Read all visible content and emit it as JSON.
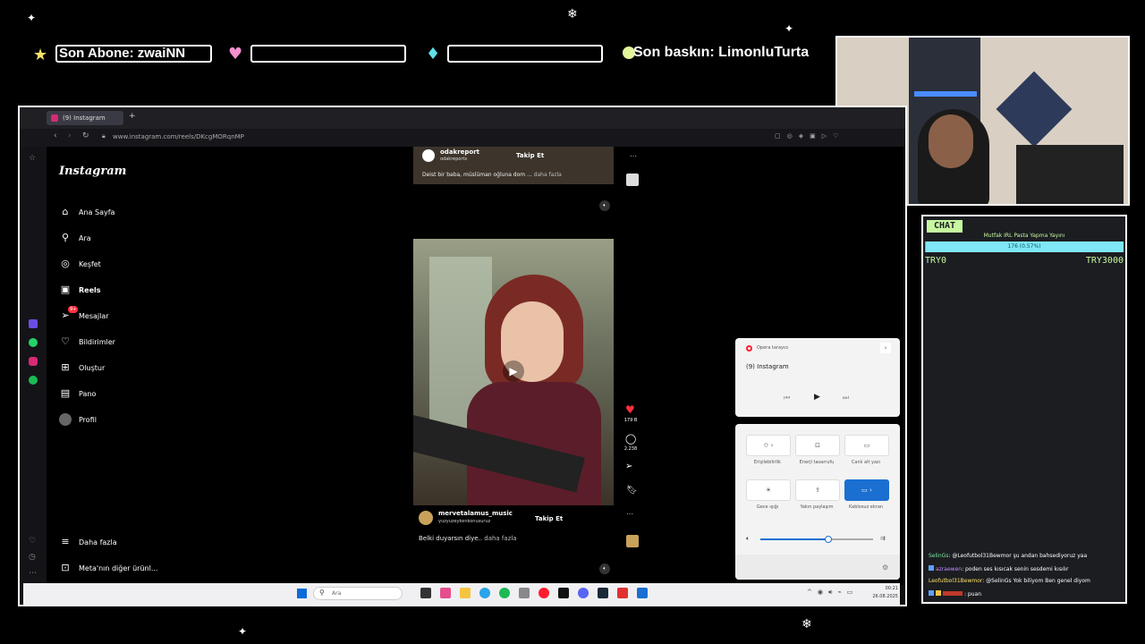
{
  "overlay": {
    "last_sub_label": "Son Abone: zwaiNN",
    "last_raid_label": "Son baskın: LimonluTurta"
  },
  "browser": {
    "tab_title": "(9) Instagram",
    "url": "www.instagram.com/reels/DKcgMORqnMP"
  },
  "instagram": {
    "logo": "Instagram",
    "nav": [
      "Ana Sayfa",
      "Ara",
      "Keşfet",
      "Reels",
      "Mesajlar",
      "Bildirimler",
      "Oluştur",
      "Pano",
      "Profil"
    ],
    "messages_badge": "9+",
    "bottom_nav": [
      "Daha fazla",
      "Meta'nın diğer ürünl..."
    ]
  },
  "reel_top": {
    "username": "odakreport",
    "subname": "odakreports",
    "follow": "Takip Et",
    "caption": "Deist bir baba, müslüman oğluna dom ...",
    "more": "daha fazla"
  },
  "reel_main": {
    "username": "mervetalamus_music",
    "subname": "yuzyuzeykenkonusuruz",
    "follow": "Takip Et",
    "caption": "Belki duyarsın diye..",
    "more": "daha fazla",
    "likes": "179 B",
    "comments": "2.238"
  },
  "media_flyout": {
    "app": "Opera tarayıcı",
    "title": "(9) Instagram"
  },
  "quick_settings": {
    "tiles": [
      "Erişilebilirlik",
      "Enerji tasarrufu",
      "Canlı alt yazı",
      "Gece ışığı",
      "Yakın paylaşım",
      "Kablosuz ekran"
    ],
    "volume_fraction": 0.6
  },
  "taskbar": {
    "search_placeholder": "Ara",
    "time": "00:21",
    "date": "26.08.2025"
  },
  "chat": {
    "header": "CHAT",
    "goal_title": "Mutfak IRL Pasta Yapma Yayını",
    "goal_progress": "176 (0.57%)",
    "goal_fraction": 0.0057,
    "goal_min": "TRY0",
    "goal_max": "TRY3000",
    "messages": [
      {
        "user": "SelinGs",
        "text": ": @Leofutbol31Bewmor şu andan bahsediyoruz yaa"
      },
      {
        "user": "azraewen",
        "text": ": poden ses kısıcak senin sesdemi kısılır"
      },
      {
        "user": "Leofutbol31Bewmor",
        "text": ": @SelinGs Yok biliyom Ben genel diyom"
      },
      {
        "user": "",
        "text": ": puan"
      }
    ]
  },
  "colors": {
    "accent_blue": "#1a6fd1",
    "like_red": "#ff3040",
    "goal_cyan": "#7fe7f5",
    "chat_header_green": "#c7f7a0"
  }
}
